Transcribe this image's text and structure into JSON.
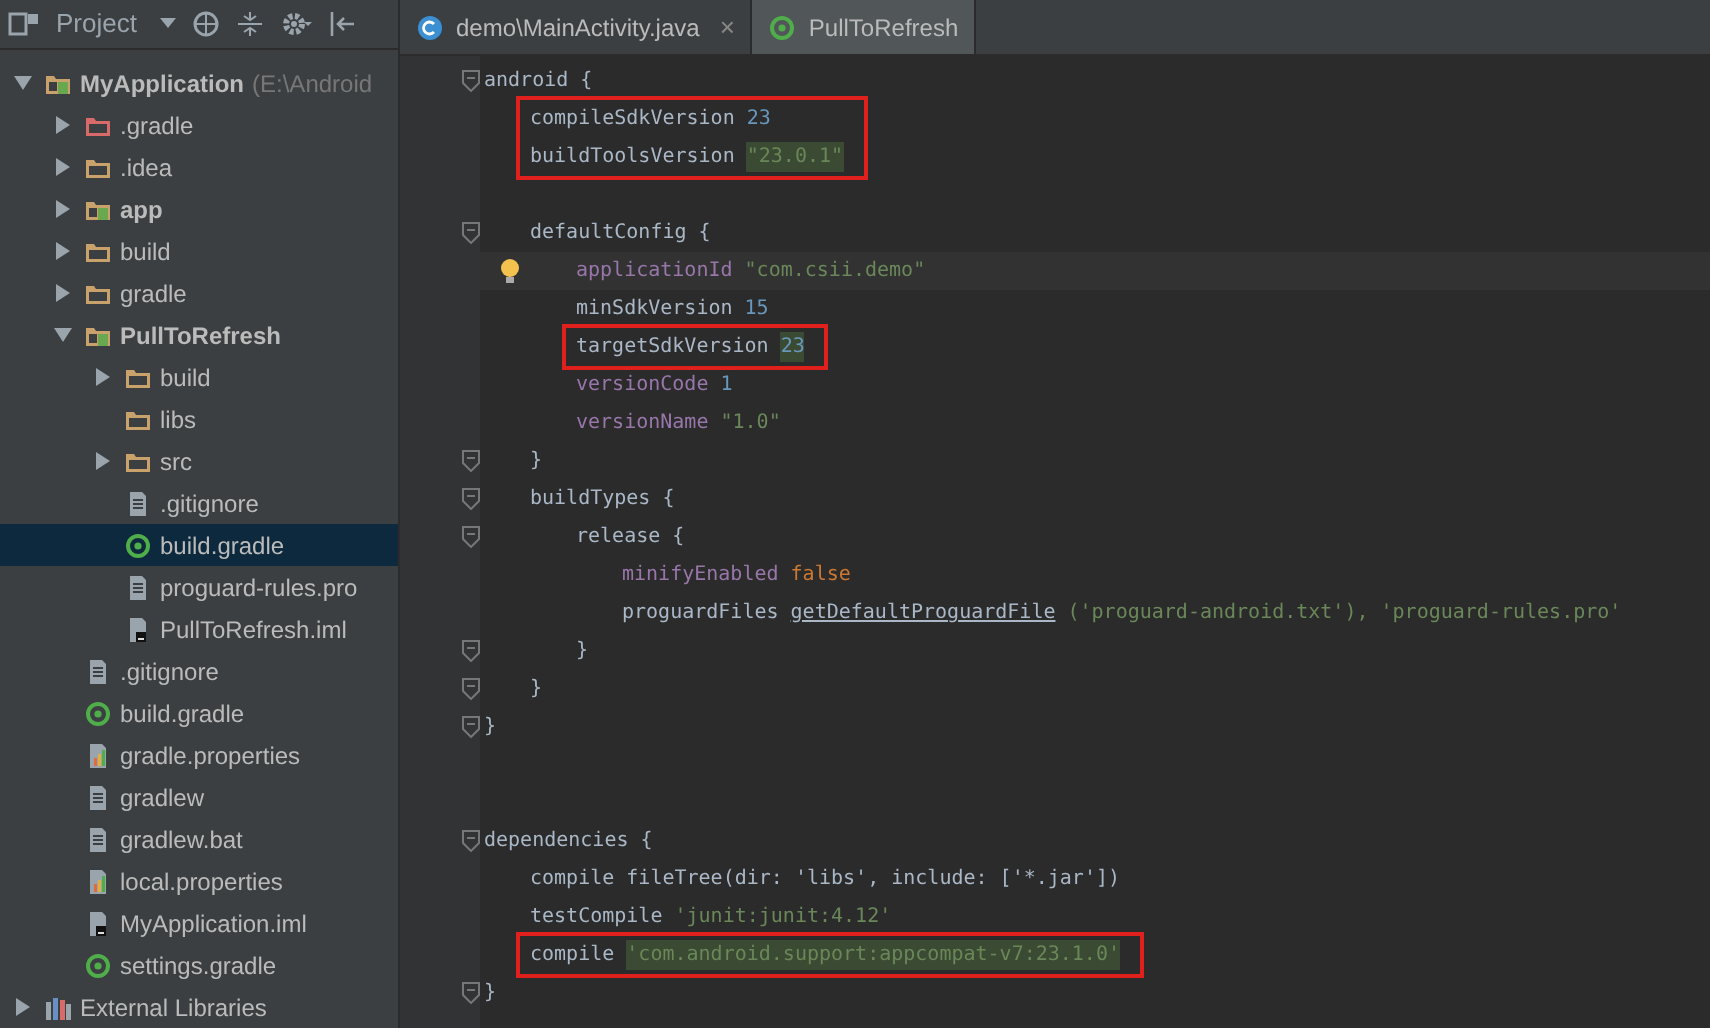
{
  "project_panel": {
    "title": "Project",
    "tree": [
      {
        "label": "MyApplication",
        "suffix": "(E:\\Android",
        "kind": "module",
        "bold": true,
        "expanded": true,
        "selected": false,
        "children": [
          {
            "label": ".gradle",
            "kind": "excluded",
            "bold": false,
            "expanded": false,
            "selected": false
          },
          {
            "label": ".idea",
            "kind": "folder",
            "bold": false,
            "expanded": false,
            "selected": false
          },
          {
            "label": "app",
            "kind": "module",
            "bold": true,
            "expanded": false,
            "selected": false
          },
          {
            "label": "build",
            "kind": "folder",
            "bold": false,
            "expanded": false,
            "selected": false
          },
          {
            "label": "gradle",
            "kind": "folder",
            "bold": false,
            "expanded": false,
            "selected": false
          },
          {
            "label": "PullToRefresh",
            "kind": "module",
            "bold": true,
            "expanded": true,
            "selected": false,
            "children": [
              {
                "label": "build",
                "kind": "folder",
                "bold": false,
                "expanded": false,
                "selected": false
              },
              {
                "label": "libs",
                "kind": "folder",
                "bold": false,
                "selected": false
              },
              {
                "label": "src",
                "kind": "folder",
                "bold": false,
                "expanded": false,
                "selected": false
              },
              {
                "label": ".gitignore",
                "kind": "text",
                "bold": false,
                "selected": false
              },
              {
                "label": "build.gradle",
                "kind": "gradle",
                "bold": false,
                "selected": true
              },
              {
                "label": "proguard-rules.pro",
                "kind": "text",
                "bold": false,
                "selected": false
              },
              {
                "label": "PullToRefresh.iml",
                "kind": "iml",
                "bold": false,
                "selected": false
              }
            ]
          },
          {
            "label": ".gitignore",
            "kind": "text",
            "bold": false,
            "selected": false
          },
          {
            "label": "build.gradle",
            "kind": "gradle",
            "bold": false,
            "selected": false
          },
          {
            "label": "gradle.properties",
            "kind": "properties",
            "bold": false,
            "selected": false
          },
          {
            "label": "gradlew",
            "kind": "text",
            "bold": false,
            "selected": false
          },
          {
            "label": "gradlew.bat",
            "kind": "text",
            "bold": false,
            "selected": false
          },
          {
            "label": "local.properties",
            "kind": "properties",
            "bold": false,
            "selected": false
          },
          {
            "label": "MyApplication.iml",
            "kind": "iml",
            "bold": false,
            "selected": false
          },
          {
            "label": "settings.gradle",
            "kind": "gradle",
            "bold": false,
            "selected": false
          }
        ]
      },
      {
        "label": "External Libraries",
        "kind": "libraries",
        "bold": false,
        "expanded": false,
        "selected": false
      }
    ]
  },
  "editor_tabs": [
    {
      "label": "demo\\MainActivity.java",
      "kind": "class",
      "close": "×",
      "selected": false
    },
    {
      "label": "PullToRefresh",
      "kind": "gradle",
      "selected": true
    }
  ],
  "code": [
    {
      "fold": true,
      "tokens": [
        {
          "text": "android {",
          "kind": "plain"
        }
      ],
      "children": [
        {
          "kind": "box",
          "children": [
            {
              "tokens": [
                {
                  "text": "compileSdkVersion",
                  "kind": "plain"
                },
                {
                  "text": "23",
                  "kind": "num"
                }
              ]
            },
            {
              "tokens": [
                {
                  "text": "buildToolsVersion",
                  "kind": "plain"
                },
                {
                  "text": "\"23.0.1\"",
                  "kind": "str",
                  "highlight": true
                }
              ]
            }
          ]
        },
        {
          "kind": "blank"
        },
        {
          "fold": true,
          "tokens": [
            {
              "text": "defaultConfig {",
              "kind": "plain"
            }
          ],
          "children": [
            {
              "bulb": true,
              "current": true,
              "tokens": [
                {
                  "text": "applicationId",
                  "kind": "prop"
                },
                {
                  "text": "\"com.csii.demo\"",
                  "kind": "str"
                }
              ]
            },
            {
              "tokens": [
                {
                  "text": "minSdkVersion",
                  "kind": "plain"
                },
                {
                  "text": "15",
                  "kind": "num"
                }
              ]
            },
            {
              "kind": "box",
              "children": [
                {
                  "tokens": [
                    {
                      "text": "targetSdkVersion",
                      "kind": "plain"
                    },
                    {
                      "text": "23",
                      "kind": "num",
                      "highlight": true
                    }
                  ]
                }
              ]
            },
            {
              "tokens": [
                {
                  "text": "versionCode",
                  "kind": "prop"
                },
                {
                  "text": "1",
                  "kind": "num"
                }
              ]
            },
            {
              "tokens": [
                {
                  "text": "versionName",
                  "kind": "prop"
                },
                {
                  "text": "\"1.0\"",
                  "kind": "str"
                }
              ]
            }
          ]
        },
        {
          "fold": true,
          "tokens": [
            {
              "text": "}",
              "kind": "plain"
            }
          ]
        },
        {
          "fold": true,
          "tokens": [
            {
              "text": "buildTypes {",
              "kind": "plain"
            }
          ],
          "children": [
            {
              "fold": true,
              "tokens": [
                {
                  "text": "release {",
                  "kind": "plain"
                }
              ],
              "children": [
                {
                  "tokens": [
                    {
                      "text": "minifyEnabled",
                      "kind": "prop"
                    },
                    {
                      "text": "false",
                      "kind": "keyword"
                    }
                  ]
                },
                {
                  "tokens": [
                    {
                      "text": "proguardFiles",
                      "kind": "plain"
                    },
                    {
                      "text": "getDefaultProguardFile",
                      "kind": "link"
                    },
                    {
                      "text": "('proguard-android.txt'), 'proguard-rules.pro'",
                      "kind": "str"
                    }
                  ]
                }
              ]
            },
            {
              "fold": true,
              "tokens": [
                {
                  "text": "}",
                  "kind": "plain"
                }
              ]
            }
          ]
        },
        {
          "fold": true,
          "tokens": [
            {
              "text": "}",
              "kind": "plain"
            }
          ]
        }
      ]
    },
    {
      "fold": true,
      "tokens": [
        {
          "text": "}",
          "kind": "plain"
        }
      ]
    },
    {
      "kind": "blank"
    },
    {
      "fold": true,
      "tokens": [
        {
          "text": "dependencies {",
          "kind": "plain"
        }
      ],
      "children": [
        {
          "tokens": [
            {
              "text": "compile fileTree(dir: 'libs', include: ['*.jar'])",
              "kind": "plain"
            }
          ]
        },
        {
          "tokens": [
            {
              "text": "testCompile",
              "kind": "plain"
            },
            {
              "text": "'junit:junit:4.12'",
              "kind": "str"
            }
          ]
        },
        {
          "kind": "box",
          "children": [
            {
              "tokens": [
                {
                  "text": "compile",
                  "kind": "plain"
                },
                {
                  "text": "'com.android.support:appcompat-v7:23.1.0'",
                  "kind": "str",
                  "highlight": true
                }
              ]
            }
          ]
        }
      ]
    },
    {
      "fold": true,
      "tokens": [
        {
          "text": "}",
          "kind": "plain"
        }
      ]
    }
  ]
}
